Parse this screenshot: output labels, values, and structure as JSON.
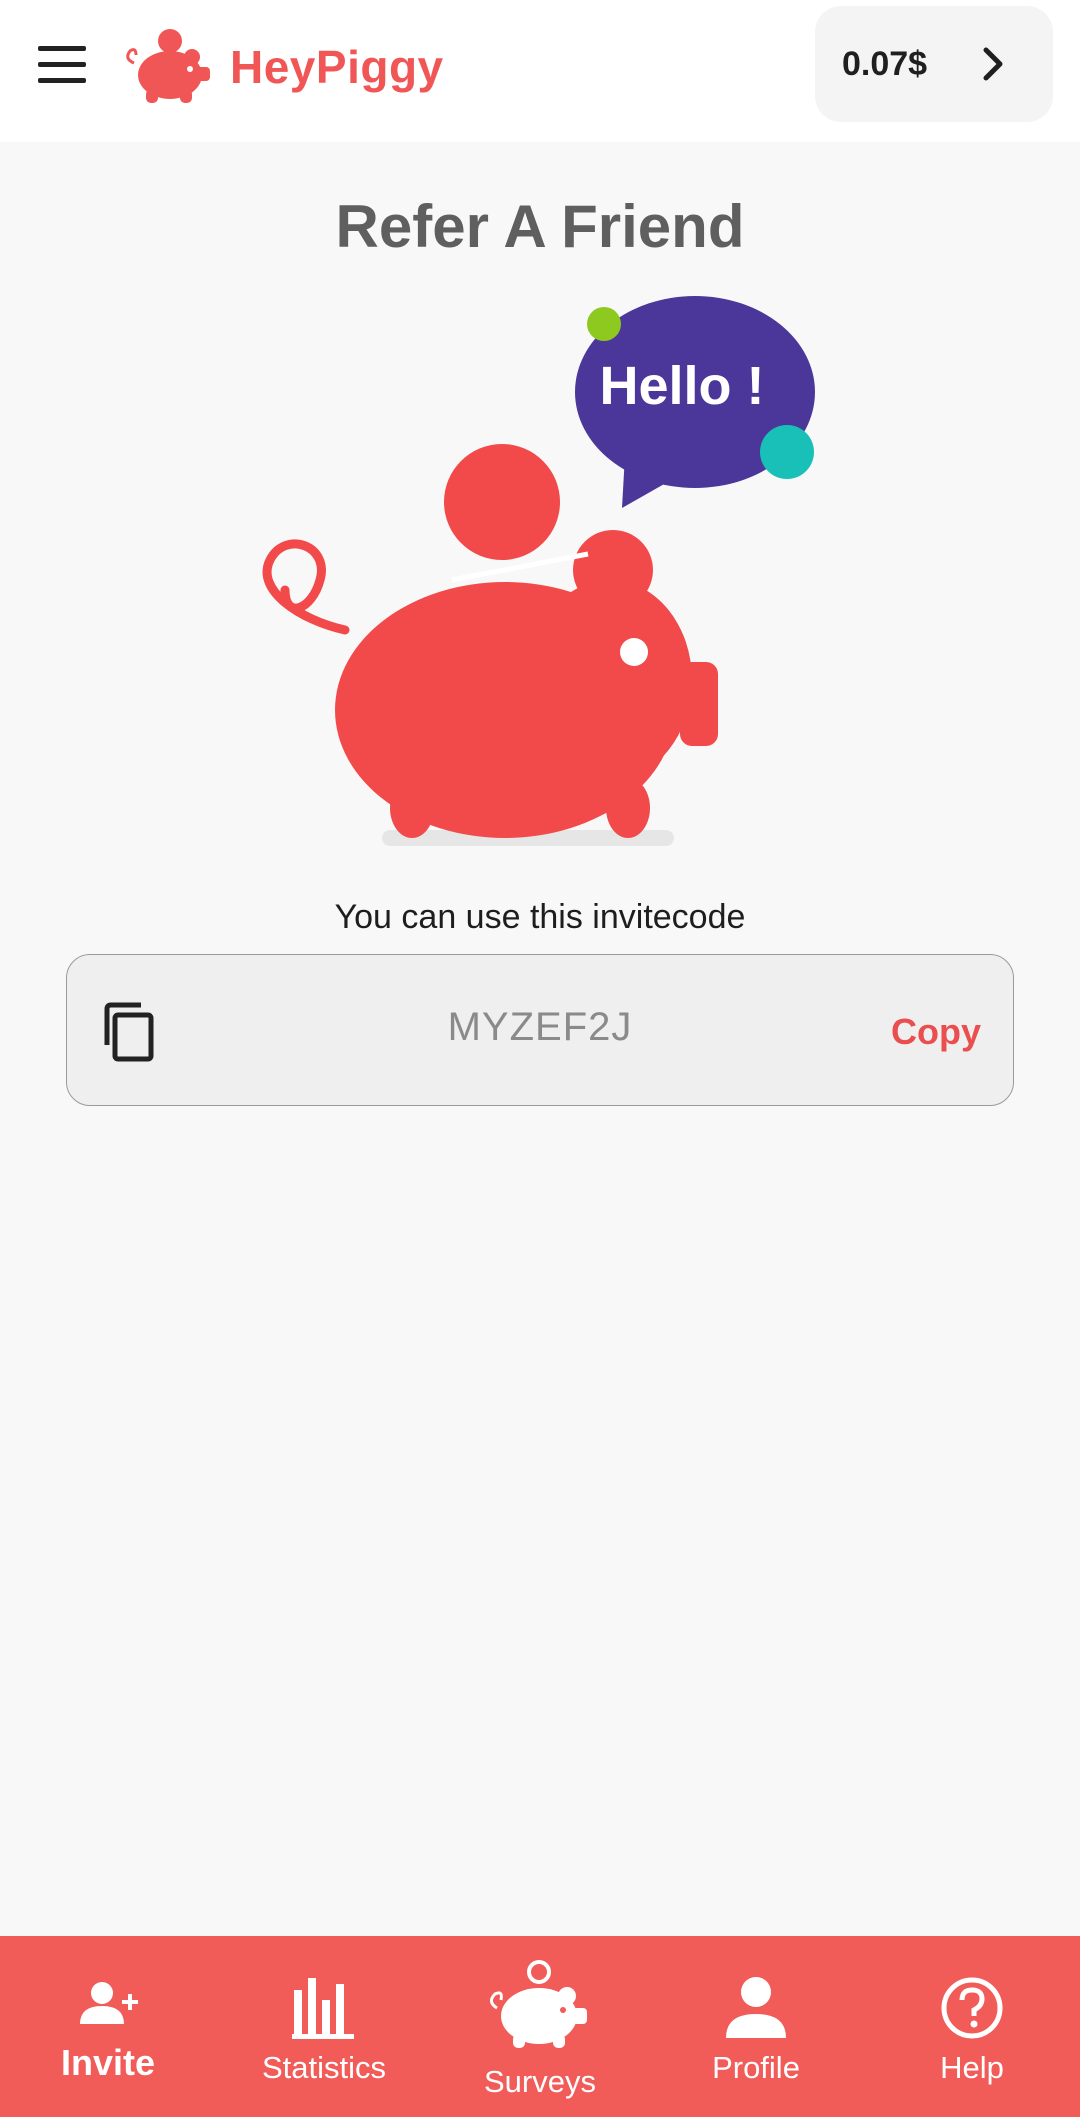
{
  "header": {
    "app_name": "HeyPiggy",
    "balance": "0.07$",
    "brand_color": "#f15656"
  },
  "main": {
    "title": "Refer A Friend",
    "speech_bubble": "Hello !",
    "invite_caption": "You can use this invitecode",
    "invite_code": "MYZEF2J",
    "copy_label": "Copy"
  },
  "nav": {
    "background": "#f15c59",
    "items": [
      {
        "label": "Invite",
        "icon": "add-user-icon",
        "active": true
      },
      {
        "label": "Statistics",
        "icon": "bar-chart-icon",
        "active": false
      },
      {
        "label": "Surveys",
        "icon": "piggy-bank-icon",
        "active": false
      },
      {
        "label": "Profile",
        "icon": "user-icon",
        "active": false
      },
      {
        "label": "Help",
        "icon": "question-icon",
        "active": false
      }
    ]
  }
}
